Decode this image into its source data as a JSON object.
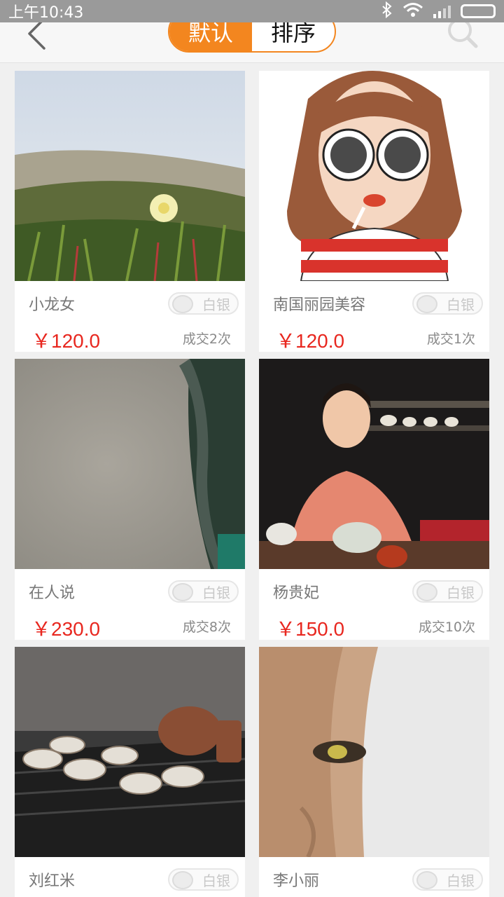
{
  "status_bar": {
    "time": "上午10:43"
  },
  "header": {
    "back_icon": "chevron-left-icon",
    "tabs": [
      {
        "label": "默认",
        "active": true
      },
      {
        "label": "排序",
        "active": false
      }
    ],
    "search_icon": "search-icon",
    "accent_color": "#f3861f"
  },
  "cards": [
    {
      "name": "小龙女",
      "badge": "白银",
      "price": "￥120.0",
      "deals": "成交2次"
    },
    {
      "name": "南国丽园美容",
      "badge": "白银",
      "price": "￥120.0",
      "deals": "成交1次"
    },
    {
      "name": "在人说",
      "badge": "白银",
      "price": "￥230.0",
      "deals": "成交8次"
    },
    {
      "name": "杨贵妃",
      "badge": "白银",
      "price": "￥150.0",
      "deals": "成交10次"
    },
    {
      "name": "刘红米",
      "badge": "白银",
      "price": "",
      "deals": ""
    },
    {
      "name": "李小丽",
      "badge": "白银",
      "price": "",
      "deals": ""
    }
  ]
}
